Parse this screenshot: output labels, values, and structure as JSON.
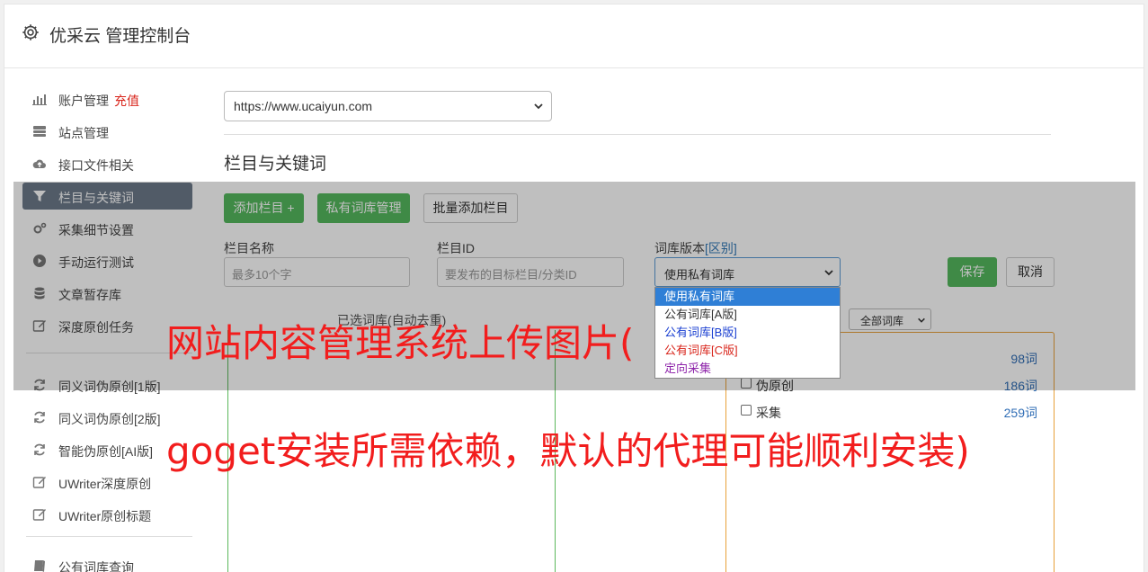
{
  "header": {
    "title": "优采云 管理控制台"
  },
  "sidebar": {
    "items": [
      {
        "label": "账户管理",
        "extra": "充值"
      },
      {
        "label": "站点管理"
      },
      {
        "label": "接口文件相关"
      },
      {
        "label": "栏目与关键词"
      },
      {
        "label": "采集细节设置"
      },
      {
        "label": "手动运行测试"
      },
      {
        "label": "文章暂存库"
      },
      {
        "label": "深度原创任务"
      },
      {
        "label": "同义词伪原创[1版]"
      },
      {
        "label": "同义词伪原创[2版]"
      },
      {
        "label": "智能伪原创[AI版]"
      },
      {
        "label": "UWriter深度原创"
      },
      {
        "label": "UWriter原创标题"
      },
      {
        "label": "公有词库查询"
      }
    ]
  },
  "main": {
    "site_select": "https://www.ucaiyun.com",
    "section_title": "栏目与关键词",
    "buttons": {
      "add_column": "添加栏目 +",
      "private_lib": "私有词库管理",
      "batch_add": "批量添加栏目",
      "save": "保存",
      "cancel": "取消"
    },
    "fields": {
      "column_name_label": "栏目名称",
      "column_name_placeholder": "最多10个字",
      "column_id_label": "栏目ID",
      "column_id_placeholder": "要发布的目标栏目/分类ID",
      "lib_version_label": "词库版本",
      "lib_version_link": "[区别]",
      "lib_version_value": "使用私有词库"
    },
    "dropdown_options": [
      "使用私有词库",
      "公有词库[A版]",
      "公有词库[B版]",
      "公有词库[C版]",
      "定向采集"
    ],
    "panel_caption": "已选词库(自动去重)",
    "lib_filter": "全部词库",
    "lib_rows": [
      {
        "name": "",
        "count": "98词"
      },
      {
        "name": "伪原创",
        "count": "186词"
      },
      {
        "name": "采集",
        "count": "259词"
      }
    ]
  },
  "overlay_text": {
    "line1": "网站内容管理系统上传图片(",
    "line2": "goget安装所需依赖，默认的代理可能顺利安装)"
  }
}
